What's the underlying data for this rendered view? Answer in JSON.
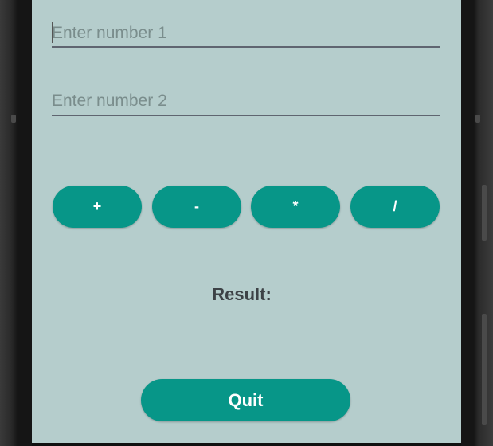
{
  "inputs": {
    "number1": {
      "placeholder": "Enter number 1",
      "value": ""
    },
    "number2": {
      "placeholder": "Enter number 2",
      "value": ""
    }
  },
  "operations": {
    "add_label": "+",
    "subtract_label": "-",
    "multiply_label": "*",
    "divide_label": "/"
  },
  "result": {
    "label": "Result:"
  },
  "quit_label": "Quit",
  "colors": {
    "screen_background": "#b5cdcc",
    "button": "#079688",
    "button_text": "#ffffff",
    "text": "#3d4246"
  }
}
